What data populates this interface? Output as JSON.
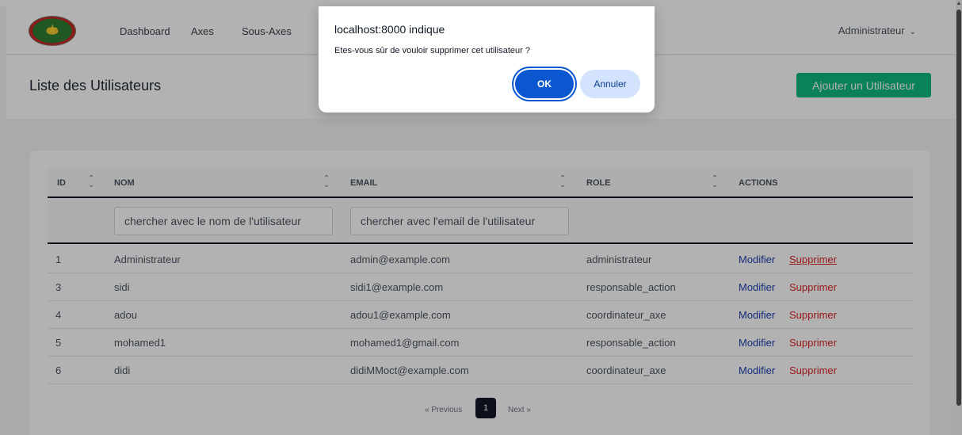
{
  "navbar": {
    "links": [
      "Dashboard",
      "Axes",
      "Sous-Axes"
    ],
    "user_menu": "Administrateur"
  },
  "header": {
    "title": "Liste des Utilisateurs",
    "add_button": "Ajouter un Utilisateur"
  },
  "table": {
    "columns": [
      "ID",
      "NOM",
      "EMAIL",
      "ROLE",
      "ACTIONS"
    ],
    "filters": {
      "name_placeholder": "chercher avec le nom de l'utilisateur",
      "email_placeholder": "chercher avec l'email de l'utilisateur"
    },
    "rows": [
      {
        "id": "1",
        "nom": "Administrateur",
        "email": "admin@example.com",
        "role": "administrateur",
        "edit": "Modifier",
        "delete": "Supprimer"
      },
      {
        "id": "3",
        "nom": "sidi",
        "email": "sidi1@example.com",
        "role": "responsable_action",
        "edit": "Modifier",
        "delete": "Supprimer"
      },
      {
        "id": "4",
        "nom": "adou",
        "email": "adou1@example.com",
        "role": "coordinateur_axe",
        "edit": "Modifier",
        "delete": "Supprimer"
      },
      {
        "id": "5",
        "nom": "mohamed1",
        "email": "mohamed1@gmail.com",
        "role": "responsable_action",
        "edit": "Modifier",
        "delete": "Supprimer"
      },
      {
        "id": "6",
        "nom": "didi",
        "email": "didiMMoct@example.com",
        "role": "coordinateur_axe",
        "edit": "Modifier",
        "delete": "Supprimer"
      }
    ]
  },
  "pagination": {
    "previous": "« Previous",
    "current": "1",
    "next": "Next »"
  },
  "dialog": {
    "title": "localhost:8000 indique",
    "message": "Etes-vous sûr de vouloir supprimer cet utilisateur ?",
    "ok": "OK",
    "cancel": "Annuler"
  },
  "colors": {
    "primary_green": "#10b981",
    "edit_blue": "#1e40af",
    "delete_red": "#dc2626",
    "dialog_ok": "#0b57d0"
  }
}
